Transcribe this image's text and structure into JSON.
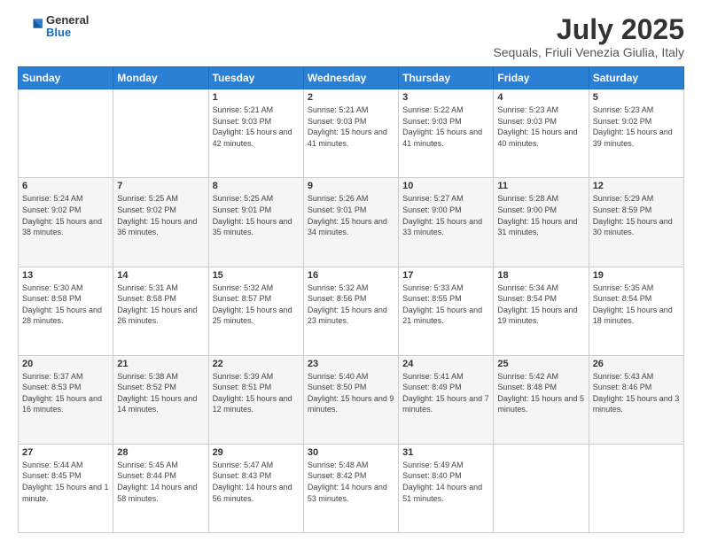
{
  "header": {
    "logo": {
      "general": "General",
      "blue": "Blue"
    },
    "title": "July 2025",
    "location": "Sequals, Friuli Venezia Giulia, Italy"
  },
  "weekdays": [
    "Sunday",
    "Monday",
    "Tuesday",
    "Wednesday",
    "Thursday",
    "Friday",
    "Saturday"
  ],
  "weeks": [
    [
      {
        "day": "",
        "sunrise": "",
        "sunset": "",
        "daylight": ""
      },
      {
        "day": "",
        "sunrise": "",
        "sunset": "",
        "daylight": ""
      },
      {
        "day": "1",
        "sunrise": "Sunrise: 5:21 AM",
        "sunset": "Sunset: 9:03 PM",
        "daylight": "Daylight: 15 hours and 42 minutes."
      },
      {
        "day": "2",
        "sunrise": "Sunrise: 5:21 AM",
        "sunset": "Sunset: 9:03 PM",
        "daylight": "Daylight: 15 hours and 41 minutes."
      },
      {
        "day": "3",
        "sunrise": "Sunrise: 5:22 AM",
        "sunset": "Sunset: 9:03 PM",
        "daylight": "Daylight: 15 hours and 41 minutes."
      },
      {
        "day": "4",
        "sunrise": "Sunrise: 5:23 AM",
        "sunset": "Sunset: 9:03 PM",
        "daylight": "Daylight: 15 hours and 40 minutes."
      },
      {
        "day": "5",
        "sunrise": "Sunrise: 5:23 AM",
        "sunset": "Sunset: 9:02 PM",
        "daylight": "Daylight: 15 hours and 39 minutes."
      }
    ],
    [
      {
        "day": "6",
        "sunrise": "Sunrise: 5:24 AM",
        "sunset": "Sunset: 9:02 PM",
        "daylight": "Daylight: 15 hours and 38 minutes."
      },
      {
        "day": "7",
        "sunrise": "Sunrise: 5:25 AM",
        "sunset": "Sunset: 9:02 PM",
        "daylight": "Daylight: 15 hours and 36 minutes."
      },
      {
        "day": "8",
        "sunrise": "Sunrise: 5:25 AM",
        "sunset": "Sunset: 9:01 PM",
        "daylight": "Daylight: 15 hours and 35 minutes."
      },
      {
        "day": "9",
        "sunrise": "Sunrise: 5:26 AM",
        "sunset": "Sunset: 9:01 PM",
        "daylight": "Daylight: 15 hours and 34 minutes."
      },
      {
        "day": "10",
        "sunrise": "Sunrise: 5:27 AM",
        "sunset": "Sunset: 9:00 PM",
        "daylight": "Daylight: 15 hours and 33 minutes."
      },
      {
        "day": "11",
        "sunrise": "Sunrise: 5:28 AM",
        "sunset": "Sunset: 9:00 PM",
        "daylight": "Daylight: 15 hours and 31 minutes."
      },
      {
        "day": "12",
        "sunrise": "Sunrise: 5:29 AM",
        "sunset": "Sunset: 8:59 PM",
        "daylight": "Daylight: 15 hours and 30 minutes."
      }
    ],
    [
      {
        "day": "13",
        "sunrise": "Sunrise: 5:30 AM",
        "sunset": "Sunset: 8:58 PM",
        "daylight": "Daylight: 15 hours and 28 minutes."
      },
      {
        "day": "14",
        "sunrise": "Sunrise: 5:31 AM",
        "sunset": "Sunset: 8:58 PM",
        "daylight": "Daylight: 15 hours and 26 minutes."
      },
      {
        "day": "15",
        "sunrise": "Sunrise: 5:32 AM",
        "sunset": "Sunset: 8:57 PM",
        "daylight": "Daylight: 15 hours and 25 minutes."
      },
      {
        "day": "16",
        "sunrise": "Sunrise: 5:32 AM",
        "sunset": "Sunset: 8:56 PM",
        "daylight": "Daylight: 15 hours and 23 minutes."
      },
      {
        "day": "17",
        "sunrise": "Sunrise: 5:33 AM",
        "sunset": "Sunset: 8:55 PM",
        "daylight": "Daylight: 15 hours and 21 minutes."
      },
      {
        "day": "18",
        "sunrise": "Sunrise: 5:34 AM",
        "sunset": "Sunset: 8:54 PM",
        "daylight": "Daylight: 15 hours and 19 minutes."
      },
      {
        "day": "19",
        "sunrise": "Sunrise: 5:35 AM",
        "sunset": "Sunset: 8:54 PM",
        "daylight": "Daylight: 15 hours and 18 minutes."
      }
    ],
    [
      {
        "day": "20",
        "sunrise": "Sunrise: 5:37 AM",
        "sunset": "Sunset: 8:53 PM",
        "daylight": "Daylight: 15 hours and 16 minutes."
      },
      {
        "day": "21",
        "sunrise": "Sunrise: 5:38 AM",
        "sunset": "Sunset: 8:52 PM",
        "daylight": "Daylight: 15 hours and 14 minutes."
      },
      {
        "day": "22",
        "sunrise": "Sunrise: 5:39 AM",
        "sunset": "Sunset: 8:51 PM",
        "daylight": "Daylight: 15 hours and 12 minutes."
      },
      {
        "day": "23",
        "sunrise": "Sunrise: 5:40 AM",
        "sunset": "Sunset: 8:50 PM",
        "daylight": "Daylight: 15 hours and 9 minutes."
      },
      {
        "day": "24",
        "sunrise": "Sunrise: 5:41 AM",
        "sunset": "Sunset: 8:49 PM",
        "daylight": "Daylight: 15 hours and 7 minutes."
      },
      {
        "day": "25",
        "sunrise": "Sunrise: 5:42 AM",
        "sunset": "Sunset: 8:48 PM",
        "daylight": "Daylight: 15 hours and 5 minutes."
      },
      {
        "day": "26",
        "sunrise": "Sunrise: 5:43 AM",
        "sunset": "Sunset: 8:46 PM",
        "daylight": "Daylight: 15 hours and 3 minutes."
      }
    ],
    [
      {
        "day": "27",
        "sunrise": "Sunrise: 5:44 AM",
        "sunset": "Sunset: 8:45 PM",
        "daylight": "Daylight: 15 hours and 1 minute."
      },
      {
        "day": "28",
        "sunrise": "Sunrise: 5:45 AM",
        "sunset": "Sunset: 8:44 PM",
        "daylight": "Daylight: 14 hours and 58 minutes."
      },
      {
        "day": "29",
        "sunrise": "Sunrise: 5:47 AM",
        "sunset": "Sunset: 8:43 PM",
        "daylight": "Daylight: 14 hours and 56 minutes."
      },
      {
        "day": "30",
        "sunrise": "Sunrise: 5:48 AM",
        "sunset": "Sunset: 8:42 PM",
        "daylight": "Daylight: 14 hours and 53 minutes."
      },
      {
        "day": "31",
        "sunrise": "Sunrise: 5:49 AM",
        "sunset": "Sunset: 8:40 PM",
        "daylight": "Daylight: 14 hours and 51 minutes."
      },
      {
        "day": "",
        "sunrise": "",
        "sunset": "",
        "daylight": ""
      },
      {
        "day": "",
        "sunrise": "",
        "sunset": "",
        "daylight": ""
      }
    ]
  ]
}
